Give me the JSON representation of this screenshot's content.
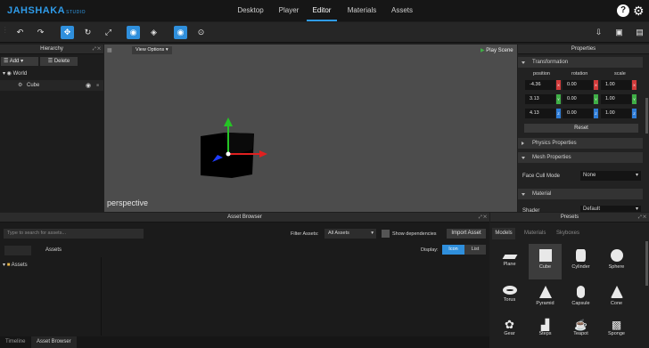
{
  "app": {
    "logo": "JAHSHAKA",
    "logo_sub": "STUDIO"
  },
  "nav": {
    "tabs": [
      "Desktop",
      "Player",
      "Editor",
      "Materials",
      "Assets"
    ],
    "active": "Editor"
  },
  "header_icons": [
    "help-icon",
    "gear-icon"
  ],
  "toolbar": {
    "buttons": [
      "undo-icon",
      "redo-icon",
      "move-icon",
      "rotate-icon",
      "scale-icon",
      "globe-icon",
      "cube-icon",
      "eye-icon",
      "target-icon"
    ],
    "right_icons": [
      "export-icon",
      "save-icon",
      "window-icon"
    ]
  },
  "hierarchy": {
    "title": "Hierarchy",
    "add_label": "Add",
    "delete_label": "Delete",
    "world_label": "World",
    "cube_label": "Cube"
  },
  "viewport": {
    "view_options": "View Options",
    "play_scene": "Play Scene",
    "camera_label": "perspective"
  },
  "properties": {
    "title": "Properties",
    "transformation": "Transformation",
    "col_position": "position",
    "col_rotation": "rotation",
    "col_scale": "scale",
    "position": [
      "-4.36",
      "3.13",
      "4.13"
    ],
    "rotation": [
      "0.00",
      "0.00",
      "0.00"
    ],
    "scale": [
      "1.00",
      "1.00",
      "1.00"
    ],
    "reset": "Reset",
    "physics": "Physics Properties",
    "mesh": "Mesh Properties",
    "face_cull_label": "Face Cull Mode",
    "face_cull_value": "None",
    "material": "Material",
    "shader_label": "Shader",
    "shader_value": "Default"
  },
  "asset_browser": {
    "title": "Asset Browser",
    "search_placeholder": "Type to search for assets...",
    "filter_label": "Filter Assets:",
    "filter_value": "All Assets",
    "show_deps": "Show dependencies",
    "import": "Import Asset",
    "display_label": "Display:",
    "icon_btn": "Icon",
    "list_btn": "List",
    "tab_assets": "Assets",
    "tree_assets": "Assets",
    "bottom_tabs": [
      "Timeline",
      "Asset Browser"
    ]
  },
  "presets": {
    "title": "Presets",
    "tabs": [
      "Models",
      "Materials",
      "Skyboxes"
    ],
    "items": [
      "Plane",
      "Cube",
      "Cylinder",
      "Sphere",
      "Torus",
      "Pyramid",
      "Capsule",
      "Cone",
      "Gear",
      "Steps",
      "Teapot",
      "Sponge"
    ]
  },
  "colors": {
    "accent": "#2f9be8",
    "x_axis": "#d23b3b",
    "y_axis": "#3fae46",
    "z_axis": "#2e7cd6"
  }
}
